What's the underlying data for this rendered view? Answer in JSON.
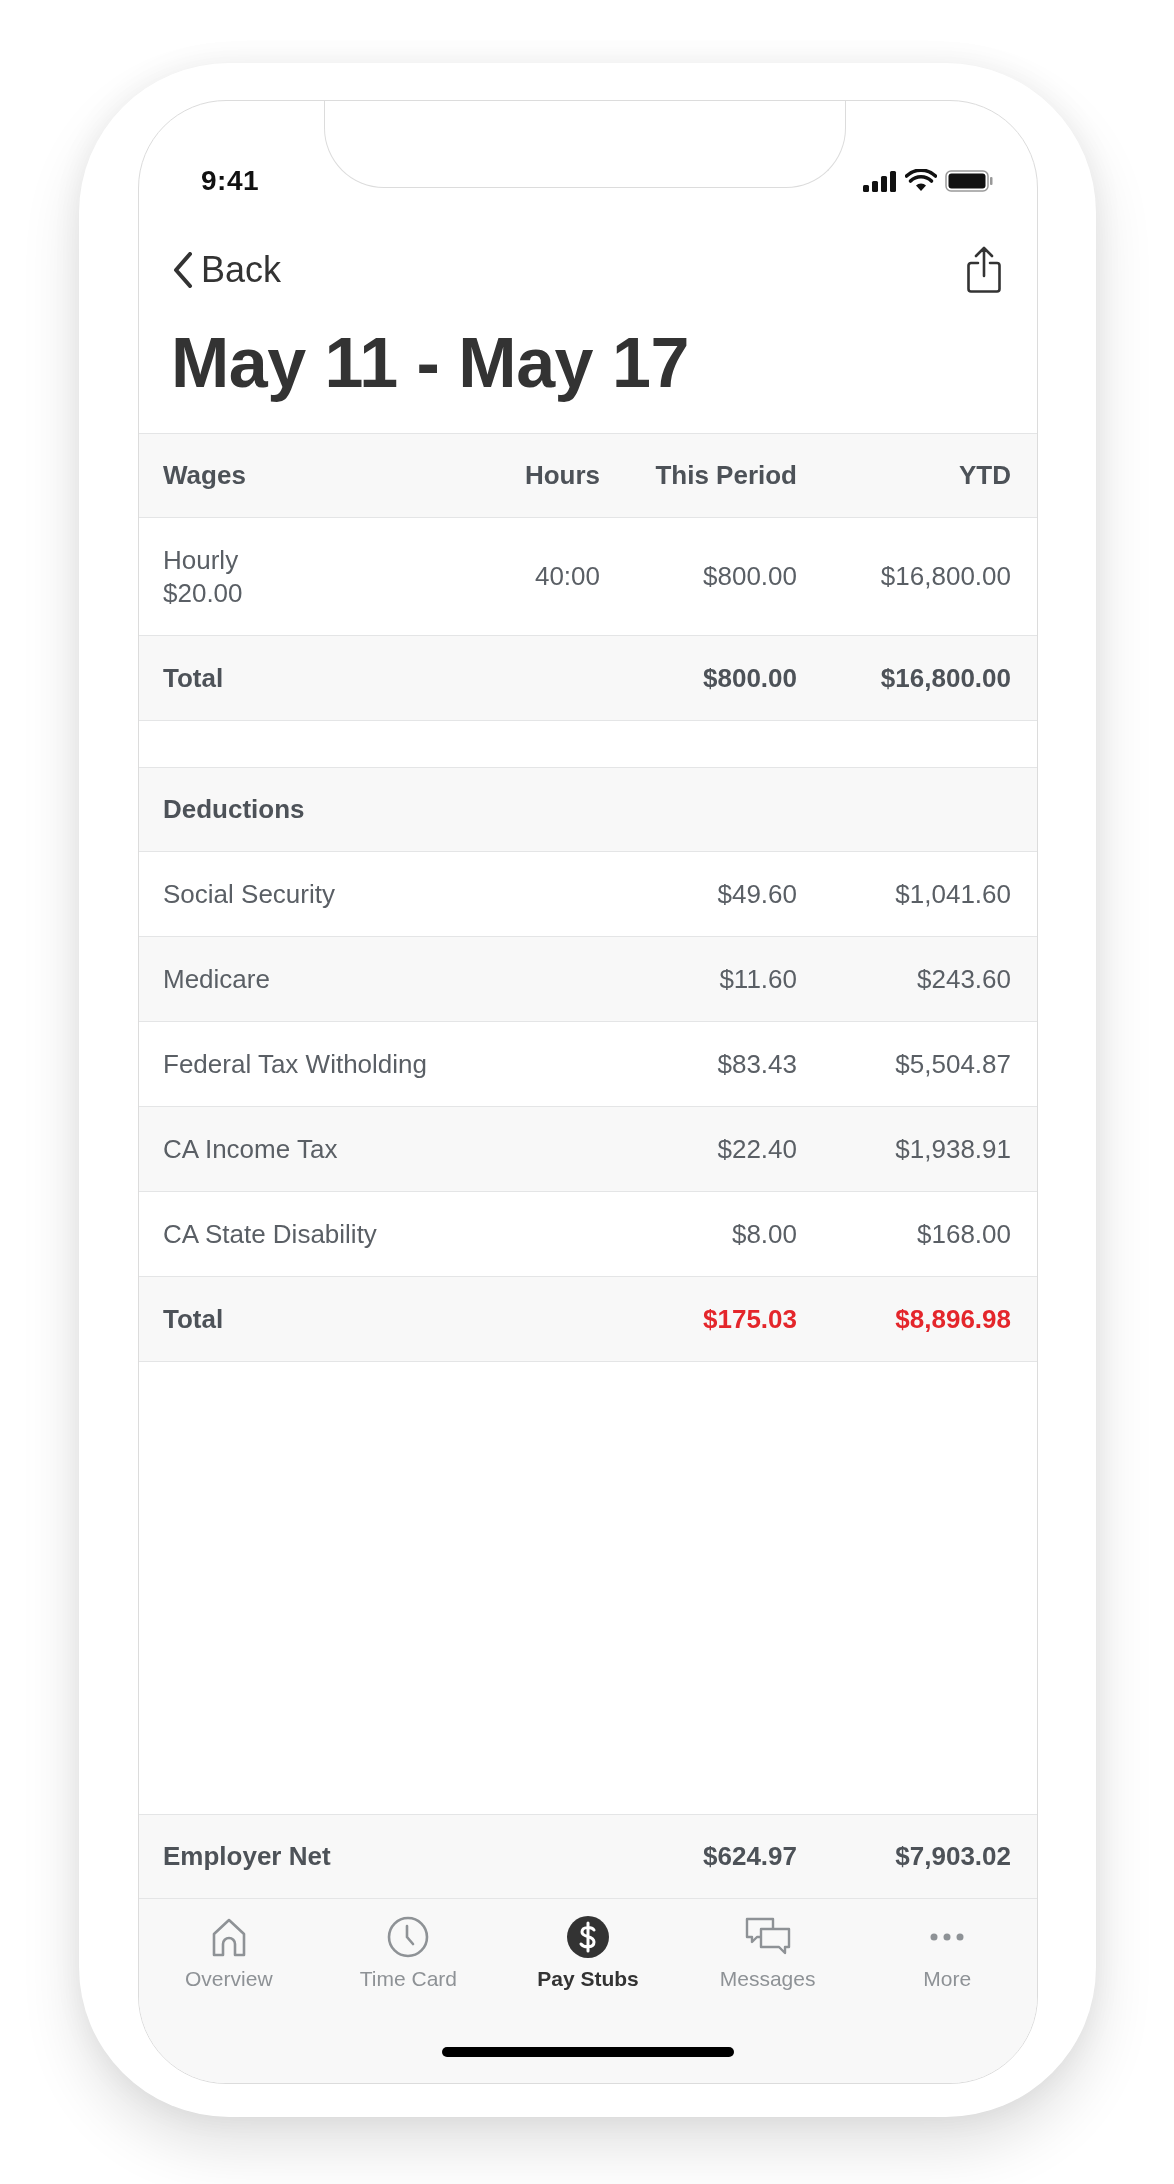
{
  "status_bar": {
    "time": "9:41"
  },
  "nav": {
    "back": "Back"
  },
  "title": "May 11 - May 17",
  "wages": {
    "columns": [
      "Wages",
      "Hours",
      "This Period",
      "YTD"
    ],
    "rows": [
      {
        "label": "Hourly",
        "rate": "$20.00",
        "hours": "40:00",
        "this_period": "$800.00",
        "ytd": "$16,800.00"
      }
    ],
    "total": {
      "label": "Total",
      "this_period": "$800.00",
      "ytd": "$16,800.00",
      "negative": false
    }
  },
  "deductions": {
    "heading": "Deductions",
    "rows": [
      {
        "label": "Social Security",
        "this_period": "$49.60",
        "ytd": "$1,041.60"
      },
      {
        "label": "Medicare",
        "this_period": "$11.60",
        "ytd": "$243.60"
      },
      {
        "label": "Federal Tax Witholding",
        "this_period": "$83.43",
        "ytd": "$5,504.87"
      },
      {
        "label": "CA Income Tax",
        "this_period": "$22.40",
        "ytd": "$1,938.91"
      },
      {
        "label": "CA State Disability",
        "this_period": "$8.00",
        "ytd": "$168.00"
      }
    ],
    "total": {
      "label": "Total",
      "this_period": "$175.03",
      "ytd": "$8,896.98",
      "negative": true
    }
  },
  "employer_net": {
    "label": "Employer Net",
    "this_period": "$624.97",
    "ytd": "$7,903.02"
  },
  "tabs": [
    {
      "label": "Overview",
      "selected": false
    },
    {
      "label": "Time Card",
      "selected": false
    },
    {
      "label": "Pay Stubs",
      "selected": true
    },
    {
      "label": "Messages",
      "selected": false
    },
    {
      "label": "More",
      "selected": false
    }
  ]
}
